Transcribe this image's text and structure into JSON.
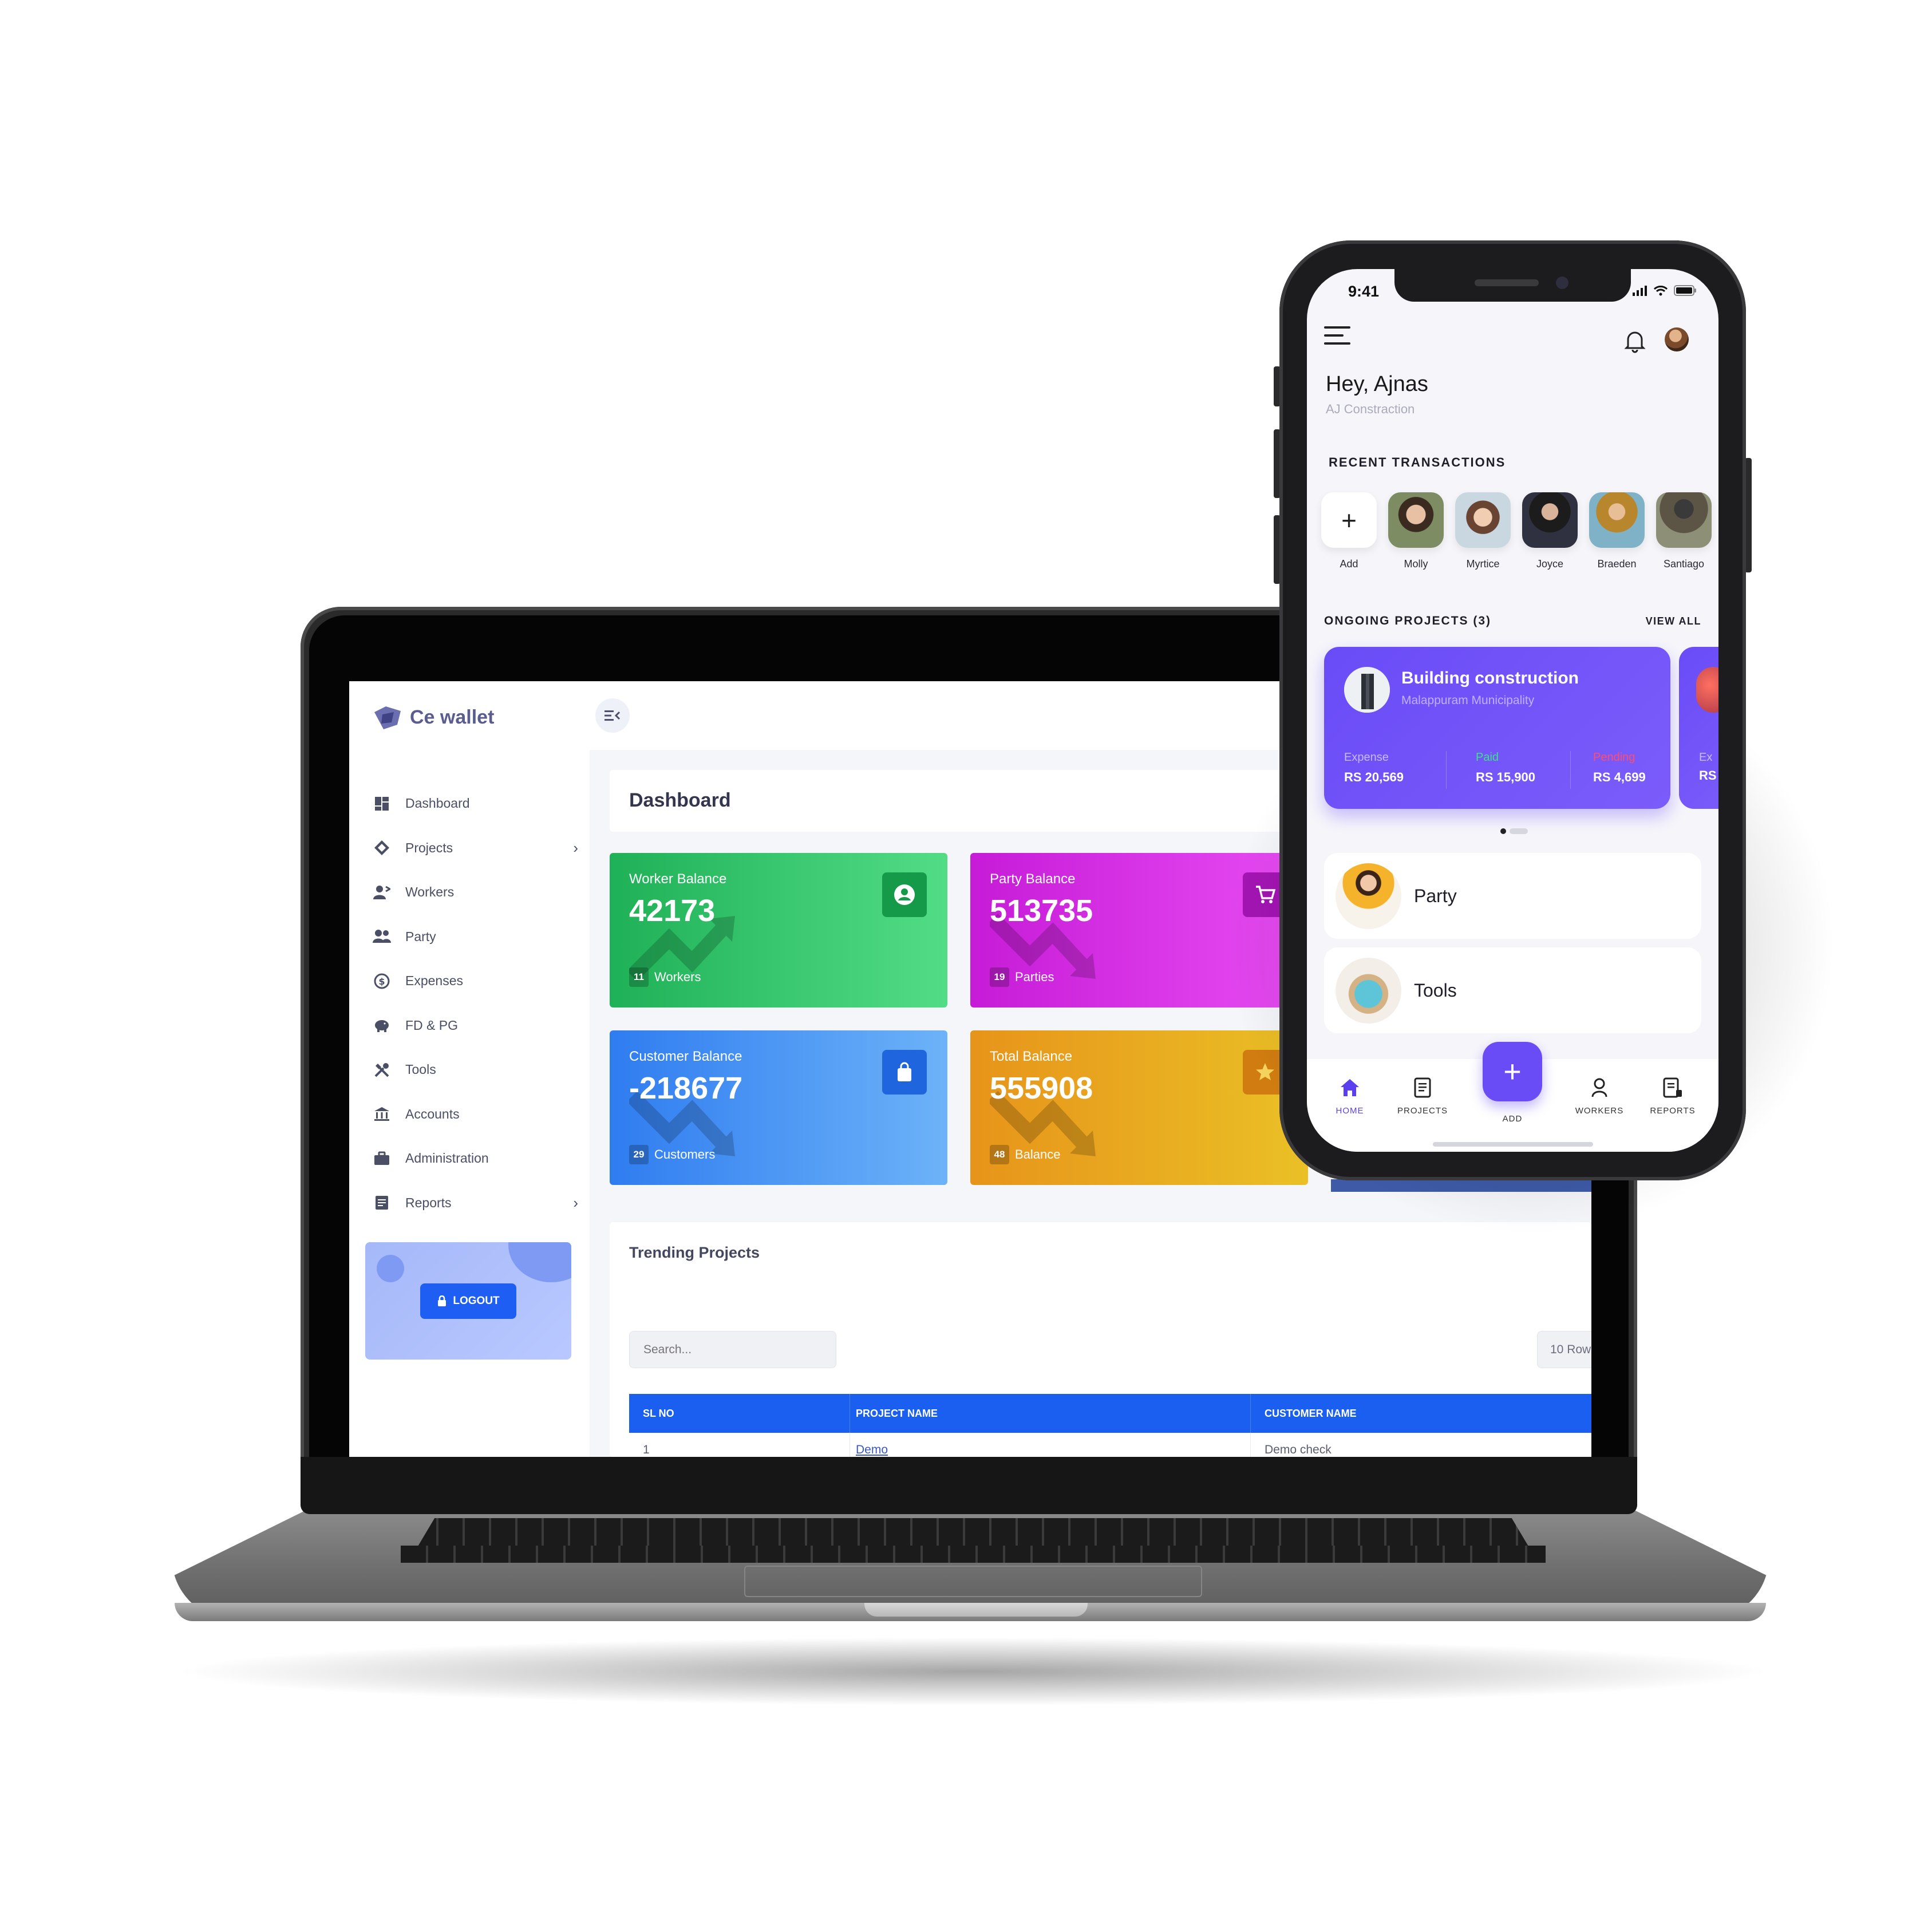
{
  "desktop": {
    "brand": "Ce wallet",
    "nav": [
      {
        "label": "Dashboard",
        "icon": "dashboard-icon",
        "has_submenu": false
      },
      {
        "label": "Projects",
        "icon": "projects-icon",
        "has_submenu": true
      },
      {
        "label": "Workers",
        "icon": "workers-icon",
        "has_submenu": false
      },
      {
        "label": "Party",
        "icon": "party-icon",
        "has_submenu": false
      },
      {
        "label": "Expenses",
        "icon": "expenses-icon",
        "has_submenu": false
      },
      {
        "label": "FD & PG",
        "icon": "piggy-bank-icon",
        "has_submenu": false
      },
      {
        "label": "Tools",
        "icon": "tools-icon",
        "has_submenu": false
      },
      {
        "label": "Accounts",
        "icon": "bank-icon",
        "has_submenu": false
      },
      {
        "label": "Administration",
        "icon": "briefcase-icon",
        "has_submenu": false
      },
      {
        "label": "Reports",
        "icon": "reports-icon",
        "has_submenu": true
      }
    ],
    "logout_label": "LOGOUT",
    "page_title": "Dashboard",
    "stats": [
      {
        "label": "Worker Balance",
        "value": "42173",
        "count": "11",
        "count_label": "Workers",
        "icon": "user-circle-icon",
        "trend": "up"
      },
      {
        "label": "Party Balance",
        "value": "513735",
        "count": "19",
        "count_label": "Parties",
        "icon": "cart-icon",
        "trend": "down"
      },
      {
        "label": "Customer Balance",
        "value": "-218677",
        "count": "29",
        "count_label": "Customers",
        "icon": "shopping-bag-icon",
        "trend": "down"
      },
      {
        "label": "Total Balance",
        "value": "555908",
        "count": "48",
        "count_label": "Balance",
        "icon": "star-icon",
        "trend": "down"
      }
    ],
    "trending": {
      "title": "Trending Projects",
      "search_placeholder": "Search...",
      "rows_select": "10 Row",
      "columns": [
        "SL NO",
        "PROJECT NAME",
        "CUSTOMER NAME"
      ],
      "rows": [
        {
          "sl_no": "1",
          "project_name": "Demo",
          "customer_name": "Demo check"
        }
      ]
    },
    "colors": {
      "primary": "#1a5ff0",
      "green": "#1fb157",
      "purple": "#c61bd7",
      "blue": "#2f7cf0",
      "orange": "#e7941a"
    }
  },
  "mobile": {
    "time": "9:41",
    "greeting": "Hey, Ajnas",
    "company": "AJ Constraction",
    "recent_title": "RECENT TRANSACTIONS",
    "contacts": [
      {
        "name": "Add",
        "icon": "plus-icon"
      },
      {
        "name": "Molly"
      },
      {
        "name": "Myrtice"
      },
      {
        "name": "Joyce"
      },
      {
        "name": "Braeden"
      },
      {
        "name": "Santiago"
      }
    ],
    "ongoing_title": "ONGOING PROJECTS (3)",
    "view_all": "VIEW ALL",
    "project": {
      "name": "Building construction",
      "location": "Malappuram Municipality",
      "expense_label": "Expense",
      "expense": "RS 20,569",
      "paid_label": "Paid",
      "paid": "RS 15,900",
      "pending_label": "Pending",
      "pending": "RS 4,699"
    },
    "next_project_peek": {
      "label": "Ex",
      "value": "RS"
    },
    "menu": [
      {
        "label": "Party"
      },
      {
        "label": "Tools"
      }
    ],
    "bottom_nav": [
      {
        "label": "HOME",
        "icon": "home-icon",
        "active": true
      },
      {
        "label": "PROJECTS",
        "icon": "projects-doc-icon",
        "active": false
      },
      {
        "label": "ADD",
        "icon": "plus-icon",
        "active": false
      },
      {
        "label": "WORKERS",
        "icon": "user-icon",
        "active": false
      },
      {
        "label": "REPORTS",
        "icon": "reports-doc-icon",
        "active": false
      }
    ],
    "colors": {
      "accent": "#6a4cf7",
      "paid": "#3fe08a",
      "pending": "#ff4d6d"
    }
  }
}
